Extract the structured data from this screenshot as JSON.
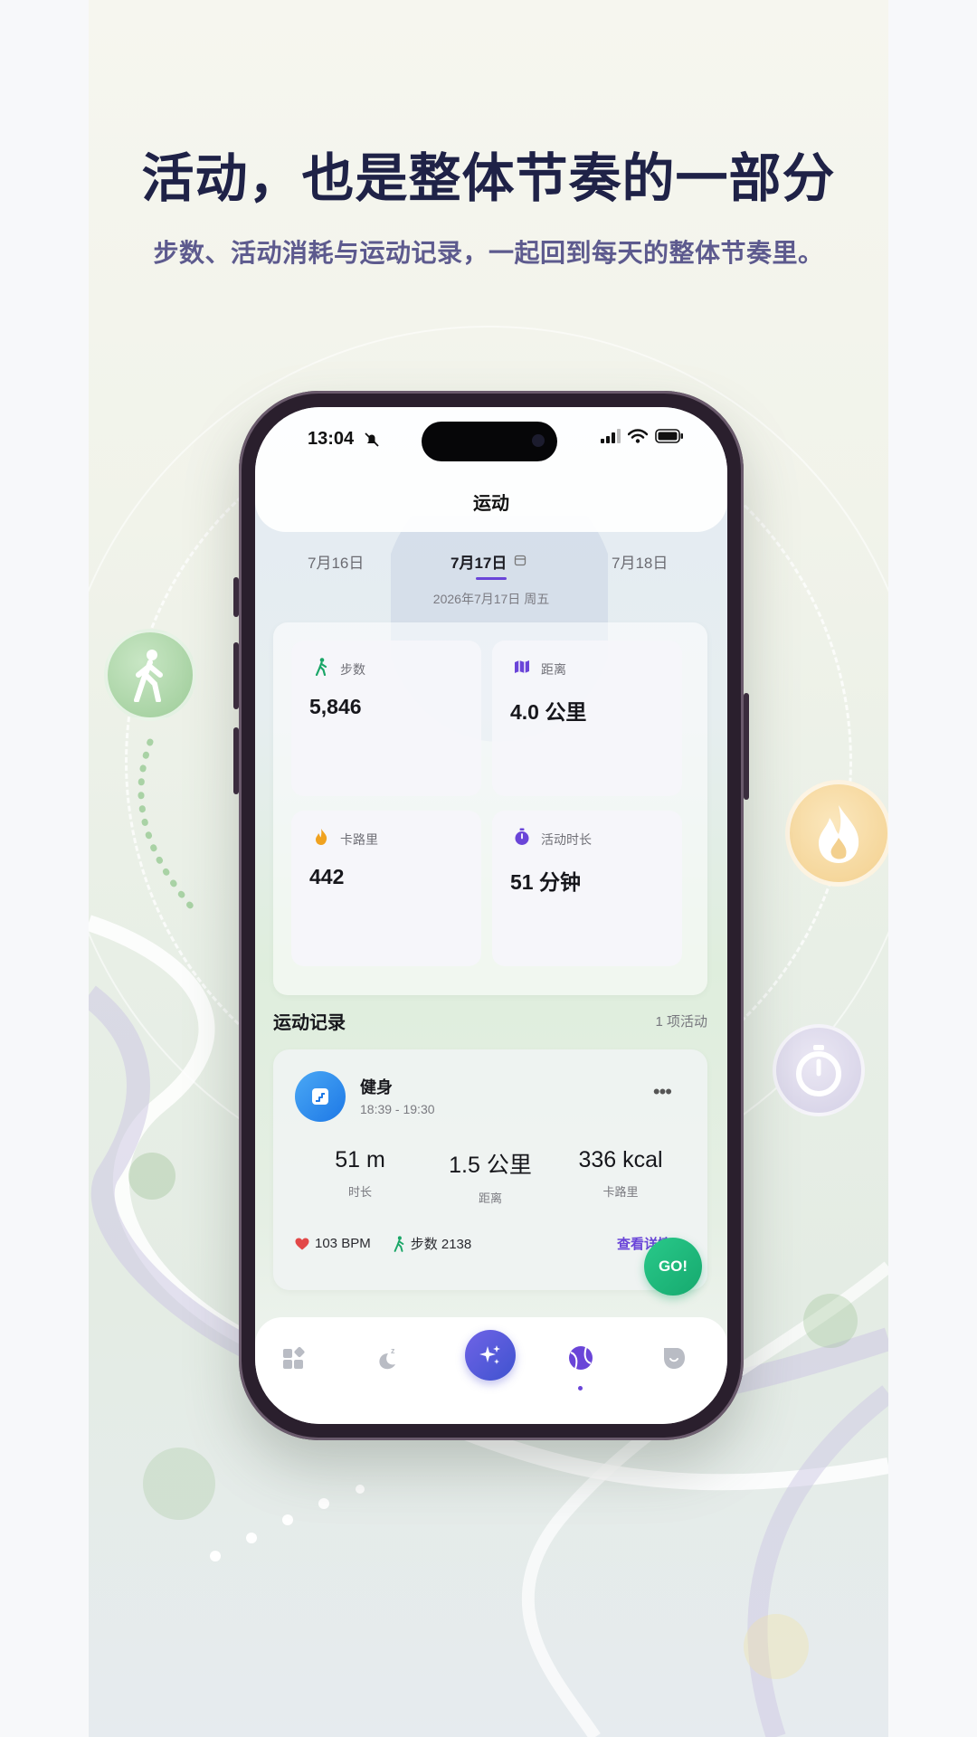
{
  "hero": {
    "title": "活动，也是整体节奏的一部分",
    "subtitle": "步数、活动消耗与运动记录，一起回到每天的整体节奏里。"
  },
  "status_bar": {
    "time": "13:04"
  },
  "page": {
    "title": "运动"
  },
  "dates": {
    "prev": "7月16日",
    "current": "7月17日",
    "next": "7月18日",
    "full": "2026年7月17日 周五"
  },
  "stats": [
    {
      "label": "步数",
      "value": "5,846",
      "icon": "walk-icon",
      "color": "#1aa667"
    },
    {
      "label": "距离",
      "value": "4.0 公里",
      "icon": "map-icon",
      "color": "#6a45d8"
    },
    {
      "label": "卡路里",
      "value": "442",
      "icon": "flame-icon",
      "color": "#f0a21f"
    },
    {
      "label": "活动时长",
      "value": "51 分钟",
      "icon": "stopwatch-icon",
      "color": "#6a45d8"
    }
  ],
  "records": {
    "heading": "运动记录",
    "count": "1 项活动",
    "item": {
      "title": "健身",
      "time": "18:39 - 19:30",
      "metrics": [
        {
          "value": "51 m",
          "label": "时长"
        },
        {
          "value": "1.5 公里",
          "label": "距离"
        },
        {
          "value": "336 kcal",
          "label": "卡路里"
        }
      ],
      "heart_rate": "103 BPM",
      "steps": "步数 2138",
      "detail_link": "查看详情"
    }
  },
  "fab": {
    "label": "GO!"
  },
  "tabbar": {
    "tabs": [
      "dashboard-icon",
      "sleep-icon",
      "sparkle-icon",
      "sport-icon",
      "mood-icon"
    ],
    "active": "sport-icon"
  },
  "colors": {
    "accent": "#6a45d8",
    "go": "#1db37a",
    "title": "#1f2247"
  }
}
